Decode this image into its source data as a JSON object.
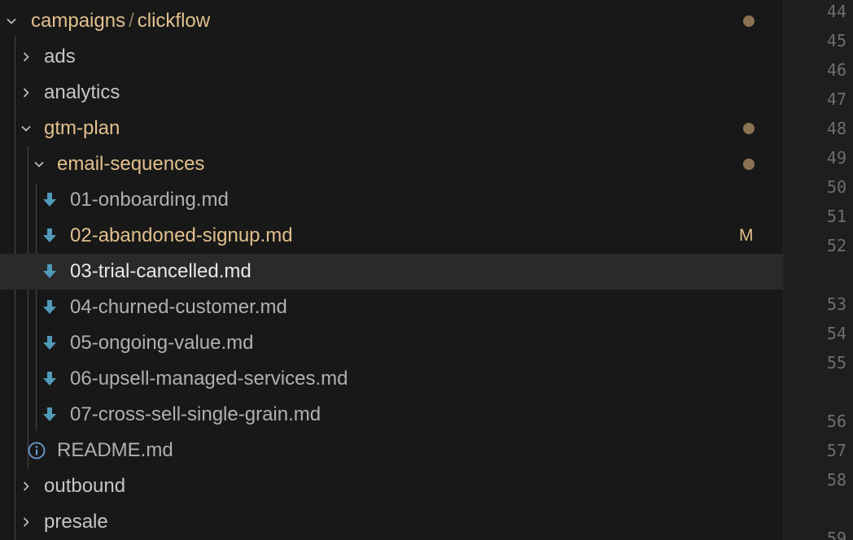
{
  "explorer": {
    "root": {
      "part1": "campaigns",
      "separator": "/",
      "part2": "clickflow"
    },
    "folders": {
      "ads": "ads",
      "analytics": "analytics",
      "gtm_plan": "gtm-plan",
      "email_sequences": "email-sequences",
      "outbound": "outbound",
      "presale": "presale"
    },
    "files": [
      {
        "name": "01-onboarding.md",
        "badge": ""
      },
      {
        "name": "02-abandoned-signup.md",
        "badge": "M"
      },
      {
        "name": "03-trial-cancelled.md",
        "badge": ""
      },
      {
        "name": "04-churned-customer.md",
        "badge": ""
      },
      {
        "name": "05-ongoing-value.md",
        "badge": ""
      },
      {
        "name": "06-upsell-managed-services.md",
        "badge": ""
      },
      {
        "name": "07-cross-sell-single-grain.md",
        "badge": ""
      }
    ],
    "readme": "README.md",
    "icons": {
      "markdown_file": "download-arrow-icon",
      "readme_file": "info-icon",
      "expanded": "chevron-down-icon",
      "collapsed": "chevron-right-icon"
    },
    "colors": {
      "modified": "#e2c08d",
      "markdown_icon": "#519aba",
      "info_icon": "#6a9fd6",
      "selected_row": "#2a2a2b"
    }
  },
  "editor": {
    "line_numbers": [
      "44",
      "45",
      "46",
      "47",
      "48",
      "49",
      "50",
      "51",
      "52",
      "53",
      "54",
      "55",
      "56",
      "57",
      "58",
      "59"
    ]
  }
}
